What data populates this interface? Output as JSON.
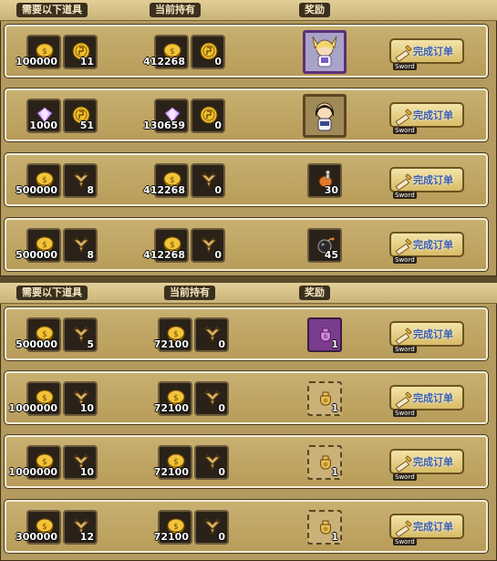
{
  "headers": {
    "required": "需要以下道具",
    "current": "当前持有",
    "reward": "奖励"
  },
  "button_label": "完成订单",
  "button_sub": "Sword",
  "colors": {
    "panel": "#b39a5e",
    "row_border": "#f5eed8",
    "button_text": "#3a5aa8"
  },
  "panel1": {
    "rows": [
      {
        "req": [
          {
            "icon": "gold-coin-icon",
            "qty": "100000"
          },
          {
            "icon": "token-coin-icon",
            "qty": "11"
          }
        ],
        "have": [
          {
            "icon": "gold-coin-icon",
            "qty": "412268"
          },
          {
            "icon": "token-coin-icon",
            "qty": "0"
          }
        ],
        "reward": {
          "icon": "fox-girl-character-icon",
          "qty": ""
        }
      },
      {
        "req": [
          {
            "icon": "gem-icon",
            "qty": "1000"
          },
          {
            "icon": "token-coin-icon",
            "qty": "51"
          }
        ],
        "have": [
          {
            "icon": "gem-icon",
            "qty": "130659"
          },
          {
            "icon": "token-coin-icon",
            "qty": "0"
          }
        ],
        "reward": {
          "icon": "dark-hair-character-icon",
          "qty": ""
        }
      },
      {
        "req": [
          {
            "icon": "gold-coin-icon",
            "qty": "500000"
          },
          {
            "icon": "wing-emblem-icon",
            "qty": "8"
          }
        ],
        "have": [
          {
            "icon": "gold-coin-icon",
            "qty": "412268"
          },
          {
            "icon": "wing-emblem-icon",
            "qty": "0"
          }
        ],
        "reward": {
          "icon": "roast-meat-icon",
          "qty": "30"
        }
      },
      {
        "req": [
          {
            "icon": "gold-coin-icon",
            "qty": "500000"
          },
          {
            "icon": "wing-emblem-icon",
            "qty": "8"
          }
        ],
        "have": [
          {
            "icon": "gold-coin-icon",
            "qty": "412268"
          },
          {
            "icon": "wing-emblem-icon",
            "qty": "0"
          }
        ],
        "reward": {
          "icon": "bomb-icon",
          "qty": "45"
        }
      }
    ]
  },
  "panel2": {
    "rows": [
      {
        "req": [
          {
            "icon": "gold-coin-icon",
            "qty": "500000"
          },
          {
            "icon": "wing-emblem-icon",
            "qty": "5"
          }
        ],
        "have": [
          {
            "icon": "gold-coin-icon",
            "qty": "72100"
          },
          {
            "icon": "wing-emblem-icon",
            "qty": "0"
          }
        ],
        "reward": {
          "icon": "purple-bag-icon",
          "qty": "1"
        }
      },
      {
        "req": [
          {
            "icon": "gold-coin-icon",
            "qty": "1000000"
          },
          {
            "icon": "wing-emblem-icon",
            "qty": "10"
          }
        ],
        "have": [
          {
            "icon": "gold-coin-icon",
            "qty": "72100"
          },
          {
            "icon": "wing-emblem-icon",
            "qty": "0"
          }
        ],
        "reward": {
          "icon": "gold-bag-icon",
          "qty": "1"
        }
      },
      {
        "req": [
          {
            "icon": "gold-coin-icon",
            "qty": "1000000"
          },
          {
            "icon": "wing-emblem-icon",
            "qty": "10"
          }
        ],
        "have": [
          {
            "icon": "gold-coin-icon",
            "qty": "72100"
          },
          {
            "icon": "wing-emblem-icon",
            "qty": "0"
          }
        ],
        "reward": {
          "icon": "gold-bag-icon",
          "qty": "1"
        }
      },
      {
        "req": [
          {
            "icon": "gold-coin-icon",
            "qty": "300000"
          },
          {
            "icon": "wing-emblem-icon",
            "qty": "12"
          }
        ],
        "have": [
          {
            "icon": "gold-coin-icon",
            "qty": "72100"
          },
          {
            "icon": "wing-emblem-icon",
            "qty": "0"
          }
        ],
        "reward": {
          "icon": "gold-bag-icon",
          "qty": "1"
        }
      }
    ]
  }
}
